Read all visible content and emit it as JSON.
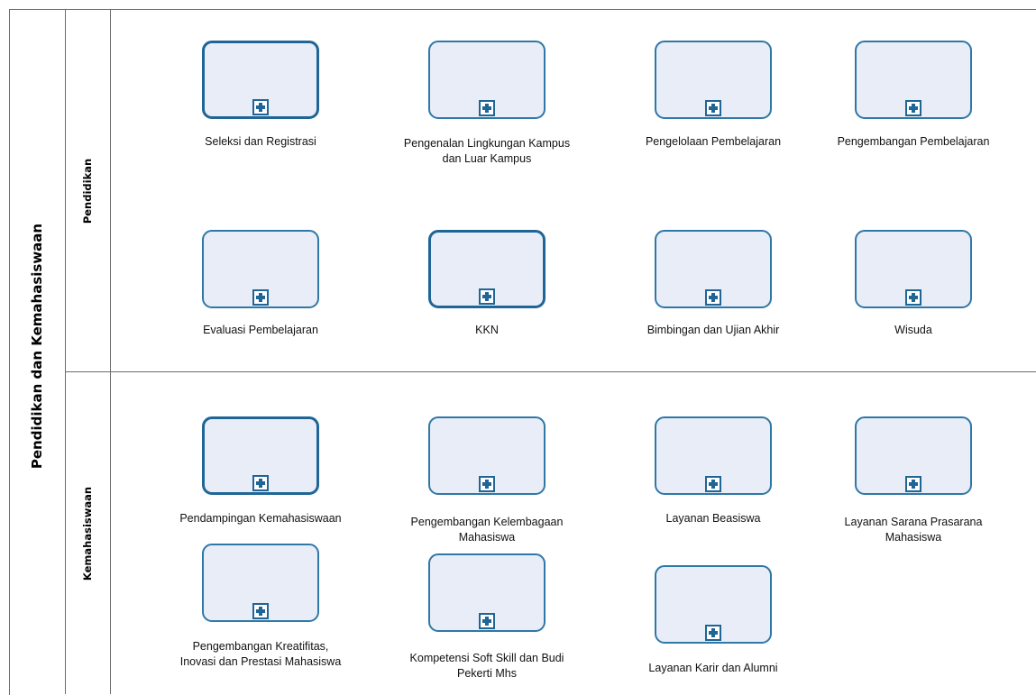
{
  "pool": {
    "title": "Pendidikan dan Kemahasiswaan"
  },
  "lanes": [
    {
      "title": "Pendidikan",
      "tasks": [
        {
          "label": "Seleksi dan Registrasi"
        },
        {
          "label": "Pengenalan Lingkungan  Kampus\ndan Luar Kampus"
        },
        {
          "label": "Pengelolaan Pembelajaran"
        },
        {
          "label": "Pengembangan Pembelajaran"
        },
        {
          "label": "Evaluasi Pembelajaran"
        },
        {
          "label": "KKN"
        },
        {
          "label": "Bimbingan dan Ujian Akhir"
        },
        {
          "label": "Wisuda"
        }
      ]
    },
    {
      "title": "Kemahasiswaan",
      "tasks": [
        {
          "label": "Pendampingan Kemahasiswaan"
        },
        {
          "label": "Pengembangan Kelembagaan\nMahasiswa"
        },
        {
          "label": "Layanan Beasiswa"
        },
        {
          "label": "Layanan Sarana Prasarana\nMahasiswa"
        },
        {
          "label": "Pengembangan Kreatifitas,\nInovasi dan Prestasi  Mahasiswa"
        },
        {
          "label": "Kompetensi Soft Skill dan Budi\nPekerti Mhs"
        },
        {
          "label": "Layanan Karir dan Alumni"
        }
      ]
    }
  ],
  "colors": {
    "task_fill": "#e9edf8",
    "task_border": "#2f78a6",
    "task_border_selected": "#1f6596",
    "lane_border": "#6d6d6d"
  },
  "icons": {
    "subprocess_marker": "plus-square-icon"
  }
}
